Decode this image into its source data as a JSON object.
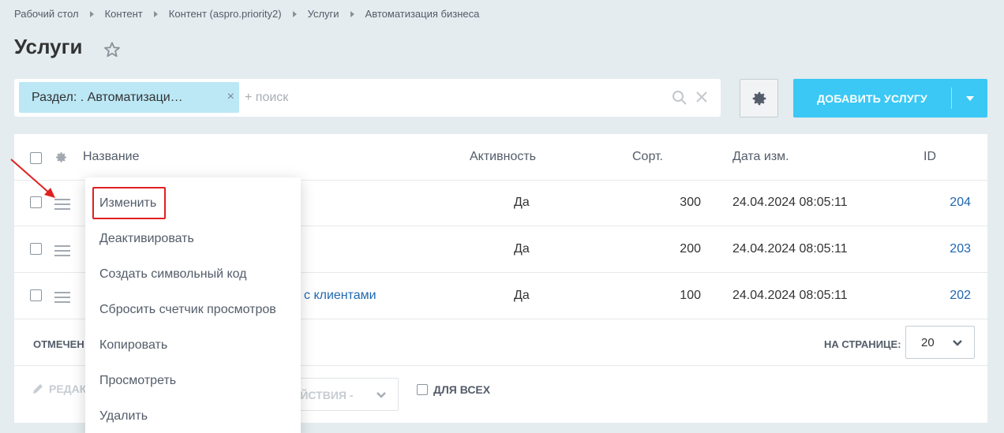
{
  "breadcrumb": [
    "Рабочий стол",
    "Контент",
    "Контент (aspro.priority2)",
    "Услуги",
    "Автоматизация бизнеса"
  ],
  "page_title": "Услуги",
  "filter": {
    "tag_label": "Раздел: . Автоматизаци…",
    "tag_close": "×",
    "search_placeholder": "+ поиск"
  },
  "add_button_label": "ДОБАВИТЬ УСЛУГУ",
  "table": {
    "headers": {
      "name": "Название",
      "active": "Активность",
      "sort": "Сорт.",
      "date": "Дата изм.",
      "id": "ID"
    },
    "rows": [
      {
        "name": "",
        "active": "Да",
        "sort": "300",
        "date": "24.04.2024 08:05:11",
        "id": "204"
      },
      {
        "name": "",
        "active": "Да",
        "sort": "200",
        "date": "24.04.2024 08:05:11",
        "id": "203"
      },
      {
        "name": "с клиентами",
        "active": "Да",
        "sort": "100",
        "date": "24.04.2024 08:05:11",
        "id": "202"
      }
    ]
  },
  "footer": {
    "marked_label": "ОТМЕЧЕН",
    "per_page_label": "НА СТРАНИЦЕ:",
    "per_page_value": "20"
  },
  "actions": {
    "edit_label": "РЕДАК",
    "select_label": "ЕЙСТВИЯ -",
    "for_all_label": "ДЛЯ ВСЕХ"
  },
  "context_menu": {
    "items": [
      "Изменить",
      "Деактивировать",
      "Создать символьный код",
      "Сбросить счетчик просмотров",
      "Копировать",
      "Просмотреть",
      "Удалить"
    ]
  },
  "colors": {
    "accent": "#3bc8f5",
    "link": "#2067b0",
    "highlight": "#e02020",
    "tag": "#bce8f6"
  }
}
